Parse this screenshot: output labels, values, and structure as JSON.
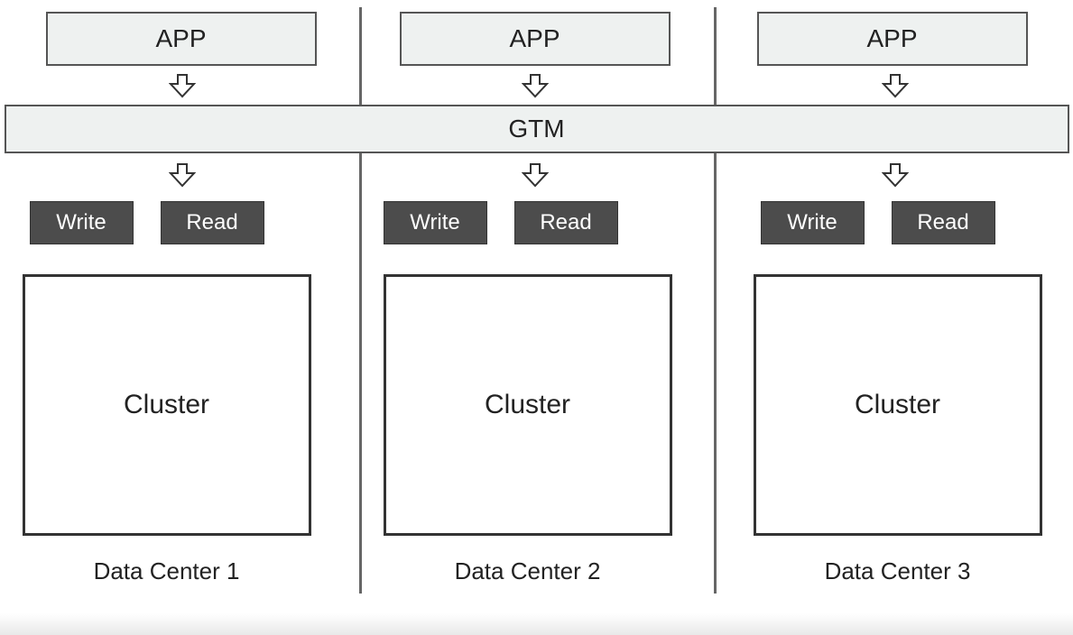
{
  "gtm_label": "GTM",
  "datacenters": [
    {
      "app_label": "APP",
      "write_label": "Write",
      "read_label": "Read",
      "cluster_label": "Cluster",
      "dc_label": "Data Center 1"
    },
    {
      "app_label": "APP",
      "write_label": "Write",
      "read_label": "Read",
      "cluster_label": "Cluster",
      "dc_label": "Data Center 2"
    },
    {
      "app_label": "APP",
      "write_label": "Write",
      "read_label": "Read",
      "cluster_label": "Cluster",
      "dc_label": "Data Center 3"
    }
  ]
}
